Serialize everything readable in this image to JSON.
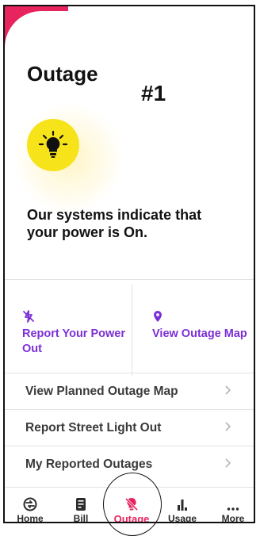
{
  "page": {
    "title": "Outage",
    "annotation": "#1"
  },
  "status": {
    "message": "Our systems indicate that your power is On."
  },
  "tiles": [
    {
      "label": "Report Your Power Out",
      "icon": "power-off-icon"
    },
    {
      "label": "View Outage Map",
      "icon": "map-pin-icon"
    }
  ],
  "list": [
    {
      "label": "View Planned Outage Map"
    },
    {
      "label": "Report Street Light Out"
    },
    {
      "label": "My Reported Outages"
    }
  ],
  "tabs": [
    {
      "label": "Home",
      "icon": "home-icon"
    },
    {
      "label": "Bill",
      "icon": "bill-icon"
    },
    {
      "label": "Outage",
      "icon": "outage-icon",
      "active": true
    },
    {
      "label": "Usage",
      "icon": "usage-icon"
    },
    {
      "label": "More",
      "icon": "more-icon"
    }
  ],
  "colors": {
    "accent": "#e8245f",
    "purple": "#7b2fd6",
    "bulb": "#f7e31a"
  }
}
